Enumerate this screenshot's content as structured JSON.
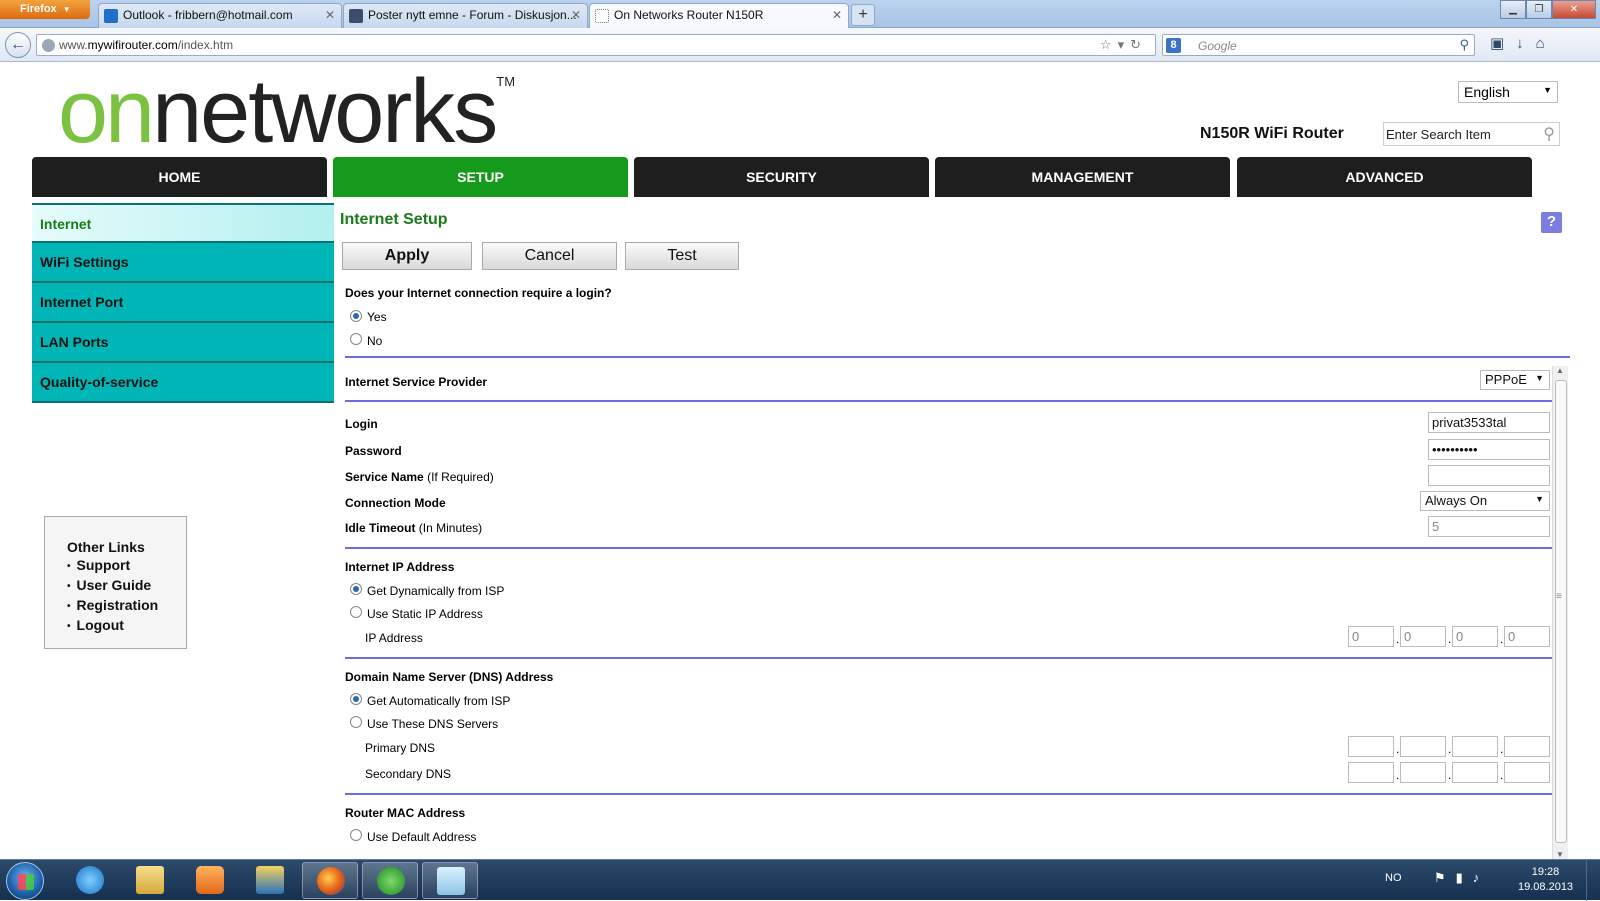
{
  "browser": {
    "menu_button": "Firefox",
    "tabs": [
      {
        "title": "Outlook - fribbern@hotmail.com",
        "icon": "outlook-icon",
        "color": "#1f6fc4"
      },
      {
        "title": "Poster nytt emne - Forum - Diskusjon...",
        "icon": "forum-icon",
        "color": "#3b4e6b"
      },
      {
        "title": "On Networks Router N150R",
        "icon": "blank-page-icon",
        "color": "#ffffff"
      }
    ],
    "url_prefix": "www.",
    "url_domain": "mywifirouter.com",
    "url_path": "/index.htm",
    "search_placeholder": "Google"
  },
  "header": {
    "logo_on": "on",
    "logo_rest": "networks",
    "logo_tm": "TM",
    "language": "English",
    "product": "N150R WiFi Router",
    "search_placeholder": "Enter Search Item"
  },
  "nav": [
    "HOME",
    "SETUP",
    "SECURITY",
    "MANAGEMENT",
    "ADVANCED"
  ],
  "nav_active": "SETUP",
  "sidebar": [
    "Internet",
    "WiFi Settings",
    "Internet Port",
    "LAN Ports",
    "Quality-of-service"
  ],
  "other_links": {
    "title": "Other Links",
    "items": [
      "Support",
      "User Guide",
      "Registration",
      "Logout"
    ]
  },
  "content": {
    "title": "Internet Setup",
    "help": "?",
    "buttons": {
      "apply": "Apply",
      "cancel": "Cancel",
      "test": "Test"
    },
    "login_question": "Does your Internet connection require a login?",
    "yes": "Yes",
    "no": "No",
    "isp_label": "Internet Service Provider",
    "isp_value": "PPPoE",
    "login_label": "Login",
    "login_value": "privat3533tal",
    "password_label": "Password",
    "password_value": "••••••••••",
    "service_name_label": "Service Name",
    "service_name_sub": "(If Required)",
    "connection_mode_label": "Connection Mode",
    "connection_mode_value": "Always On",
    "idle_timeout_label": "Idle Timeout",
    "idle_timeout_sub": "(In Minutes)",
    "idle_timeout_value": "5",
    "ip_section": "Internet IP Address",
    "ip_dynamic": "Get Dynamically from ISP",
    "ip_static": "Use Static IP Address",
    "ip_address_label": "IP Address",
    "ip_octets": [
      "0",
      "0",
      "0",
      "0"
    ],
    "dns_section": "Domain Name Server (DNS) Address",
    "dns_auto": "Get Automatically from ISP",
    "dns_manual": "Use These DNS Servers",
    "primary_dns": "Primary DNS",
    "secondary_dns": "Secondary DNS",
    "mac_section": "Router MAC Address",
    "mac_default": "Use Default Address"
  },
  "taskbar": {
    "lang": "NO",
    "time": "19:28",
    "date": "19.08.2013"
  }
}
